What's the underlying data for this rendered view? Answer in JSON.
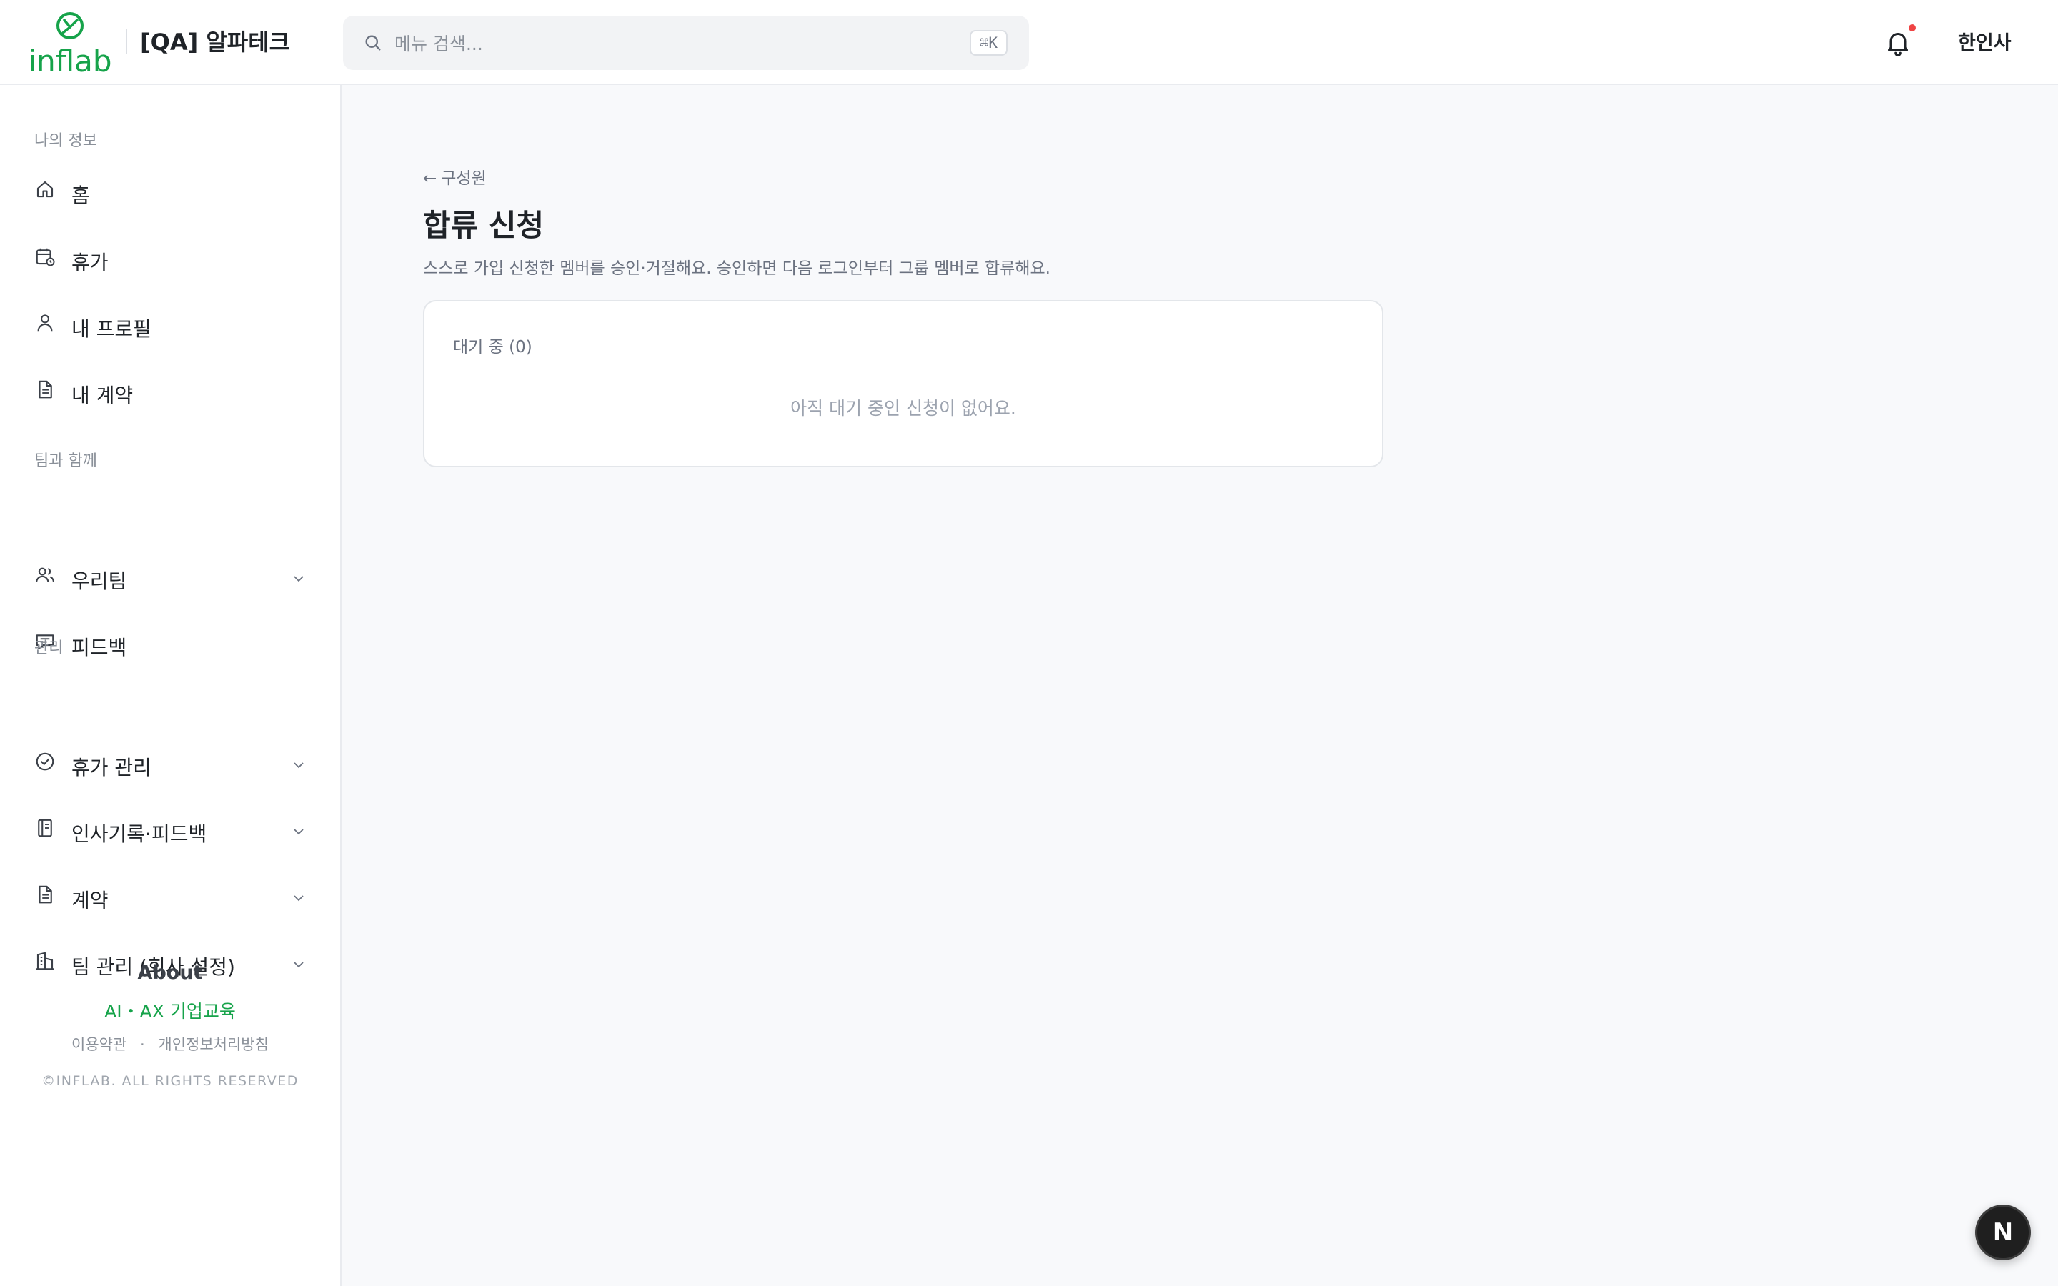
{
  "header": {
    "org_name": "[QA] 알파테크",
    "search_placeholder": "메뉴 검색...",
    "search_shortcut": "⌘K",
    "user_name": "한인사",
    "notification_dot_color": "#ef4444",
    "logo_color": "#16a34a"
  },
  "sidebar": {
    "sections": [
      {
        "label": "나의 정보"
      },
      {
        "label": "팀과 함께"
      },
      {
        "label": "관리"
      }
    ],
    "items": [
      {
        "label": "홈",
        "icon": "home-icon"
      },
      {
        "label": "휴가",
        "icon": "calendar-clock-icon"
      },
      {
        "label": "내 프로필",
        "icon": "user-icon"
      },
      {
        "label": "내 계약",
        "icon": "document-icon"
      },
      {
        "label": "우리팀",
        "icon": "users-icon",
        "expandable": true
      },
      {
        "label": "피드백",
        "icon": "message-square-icon"
      },
      {
        "label": "휴가 관리",
        "icon": "check-circle-icon",
        "expandable": true
      },
      {
        "label": "인사기록·피드백",
        "icon": "notebook-icon",
        "expandable": true
      },
      {
        "label": "계약",
        "icon": "document-icon",
        "expandable": true
      },
      {
        "label": "팀 관리 (회사 설정)",
        "icon": "building-icon",
        "expandable": true
      }
    ],
    "about": {
      "title": "About",
      "link": "AI・AX 기업교육",
      "terms": "이용약관",
      "separator": "·",
      "privacy": "개인정보처리방침",
      "copyright": "©INFLAB. ALL RIGHTS RESERVED",
      "link_color": "#16a34a"
    }
  },
  "main": {
    "back_label": "구성원",
    "back_arrow": "←",
    "title": "합류 신청",
    "description": "스스로 가입 신청한 멤버를 승인·거절해요. 승인하면 다음 로그인부터 그룹 멤버로 합류해요.",
    "pending": {
      "title": "대기 중 (0)",
      "empty_message": "아직 대기 중인 신청이 없어요."
    }
  },
  "fab": {
    "label": "N"
  }
}
